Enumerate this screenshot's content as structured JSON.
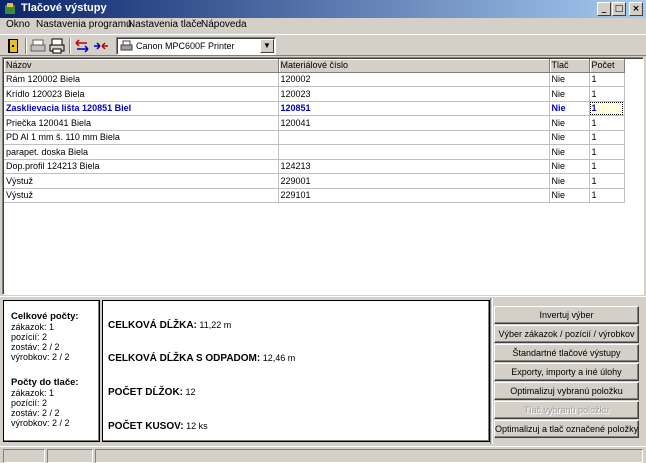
{
  "window": {
    "title": "Tlačové výstupy",
    "minimize_label": "_",
    "maximize_label": "□",
    "close_label": "×"
  },
  "menu": [
    "Okno",
    "Nastavenia programu",
    "Nastavenia tlače",
    "Nápoveda"
  ],
  "toolbar": {
    "printer": "Canon MPC600F Printer",
    "dropdown_arrow": "▼"
  },
  "grid": {
    "columns": [
      "Názov",
      "Materiálové číslo",
      "Tlač",
      "Počet"
    ],
    "rows": [
      {
        "name": "Rám 120002 Biela",
        "material": "120002",
        "print": "Nie",
        "count": "1"
      },
      {
        "name": "Krídlo 120023 Biela",
        "material": "120023",
        "print": "Nie",
        "count": "1"
      },
      {
        "name": "Zasklievacia lišta 120851 Biel",
        "material": "120851",
        "print": "Nie",
        "count": "1"
      },
      {
        "name": "Priečka 120041 Biela",
        "material": "120041",
        "print": "Nie",
        "count": "1"
      },
      {
        "name": "PD Al 1 mm š. 110 mm Biela",
        "material": "",
        "print": "Nie",
        "count": "1"
      },
      {
        "name": "parapet. doska Biela",
        "material": "",
        "print": "Nie",
        "count": "1"
      },
      {
        "name": "Dop.profil 124213 Biela",
        "material": "124213",
        "print": "Nie",
        "count": "1"
      },
      {
        "name": "Výstuž",
        "material": "229001",
        "print": "Nie",
        "count": "1"
      },
      {
        "name": "Výstuž",
        "material": "229101",
        "print": "Nie",
        "count": "1"
      }
    ],
    "selected_row": 2
  },
  "summary": {
    "total_heading": "Celkové počty:",
    "total_lines": [
      "zákazok: 1",
      "pozícií: 2",
      "zostáv: 2 / 2",
      "výrobkov: 2 / 2"
    ],
    "print_heading": "Počty do tlače:",
    "print_lines": [
      "zákazok: 1",
      "pozícií: 2",
      "zostáv: 2 / 2",
      "výrobkov: 2 / 2"
    ]
  },
  "details": [
    {
      "key": "CELKOVÁ DĹŽKA:",
      "value": "11,22 m"
    },
    {
      "key": "CELKOVÁ DĹŽKA S ODPADOM:",
      "value": "12,46 m"
    },
    {
      "key": "POČET DĹŽOK:",
      "value": "12"
    },
    {
      "key": "POČET KUSOV:",
      "value": "12 ks"
    }
  ],
  "actions": [
    {
      "label": "Invertuj výber",
      "enabled": true
    },
    {
      "label": "Výber zákazok / pozícií / výrobkov",
      "enabled": true
    },
    {
      "label": "Štandartné tlačové výstupy",
      "enabled": true
    },
    {
      "label": "Exporty, importy a iné úlohy",
      "enabled": true
    },
    {
      "label": "Optimalizuj vybranú položku",
      "enabled": true
    },
    {
      "label": "Tlač vybranú položku",
      "enabled": false
    },
    {
      "label": "Optimalizuj a tlač označené položky",
      "enabled": true
    }
  ]
}
